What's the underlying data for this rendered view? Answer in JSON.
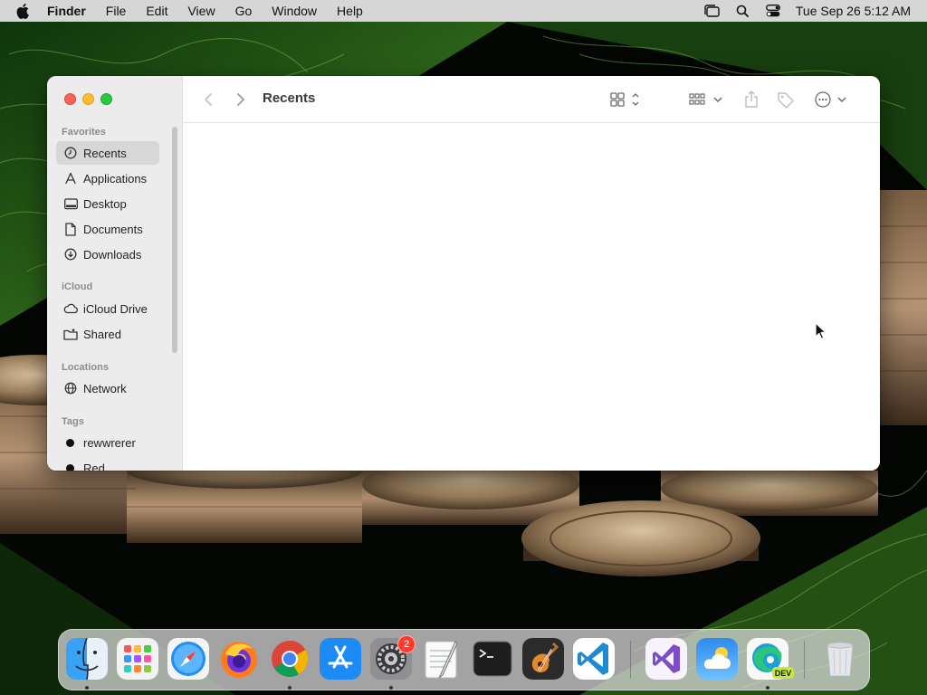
{
  "menubar": {
    "app_name": "Finder",
    "items": [
      "File",
      "Edit",
      "View",
      "Go",
      "Window",
      "Help"
    ],
    "clock": "Tue Sep 26  5:12 AM"
  },
  "finder": {
    "title": "Recents",
    "sidebar": {
      "favorites_header": "Favorites",
      "favorites": [
        {
          "label": "Recents",
          "icon": "clock-icon",
          "selected": true
        },
        {
          "label": "Applications",
          "icon": "applications-icon"
        },
        {
          "label": "Desktop",
          "icon": "desktop-icon"
        },
        {
          "label": "Documents",
          "icon": "document-icon"
        },
        {
          "label": "Downloads",
          "icon": "download-icon"
        }
      ],
      "icloud_header": "iCloud",
      "icloud": [
        {
          "label": "iCloud Drive",
          "icon": "cloud-icon"
        },
        {
          "label": "Shared",
          "icon": "shared-folder-icon"
        }
      ],
      "locations_header": "Locations",
      "locations": [
        {
          "label": "Network",
          "icon": "globe-icon"
        }
      ],
      "tags_header": "Tags",
      "tags": [
        {
          "label": "rewwrerer",
          "color": "#111111"
        },
        {
          "label": "Red",
          "color": "#111111"
        }
      ]
    }
  },
  "dock": {
    "apps": [
      {
        "name": "Finder",
        "running": true
      },
      {
        "name": "Launchpad"
      },
      {
        "name": "Safari"
      },
      {
        "name": "Firefox"
      },
      {
        "name": "Google Chrome",
        "running": true
      },
      {
        "name": "App Store"
      },
      {
        "name": "System Settings",
        "badge": "2",
        "running": true
      },
      {
        "name": "TextEdit"
      },
      {
        "name": "Terminal"
      },
      {
        "name": "GarageBand"
      },
      {
        "name": "Visual Studio Code"
      },
      {
        "name": "Visual Studio"
      },
      {
        "name": "Weather"
      },
      {
        "name": "Microsoft Edge Dev",
        "label": "DEV",
        "running": true
      },
      {
        "name": "Trash"
      }
    ]
  },
  "colors": {
    "close": "#fe5f57",
    "minimize": "#febc2e",
    "maximize": "#28c840",
    "badge": "#ff3b30"
  }
}
